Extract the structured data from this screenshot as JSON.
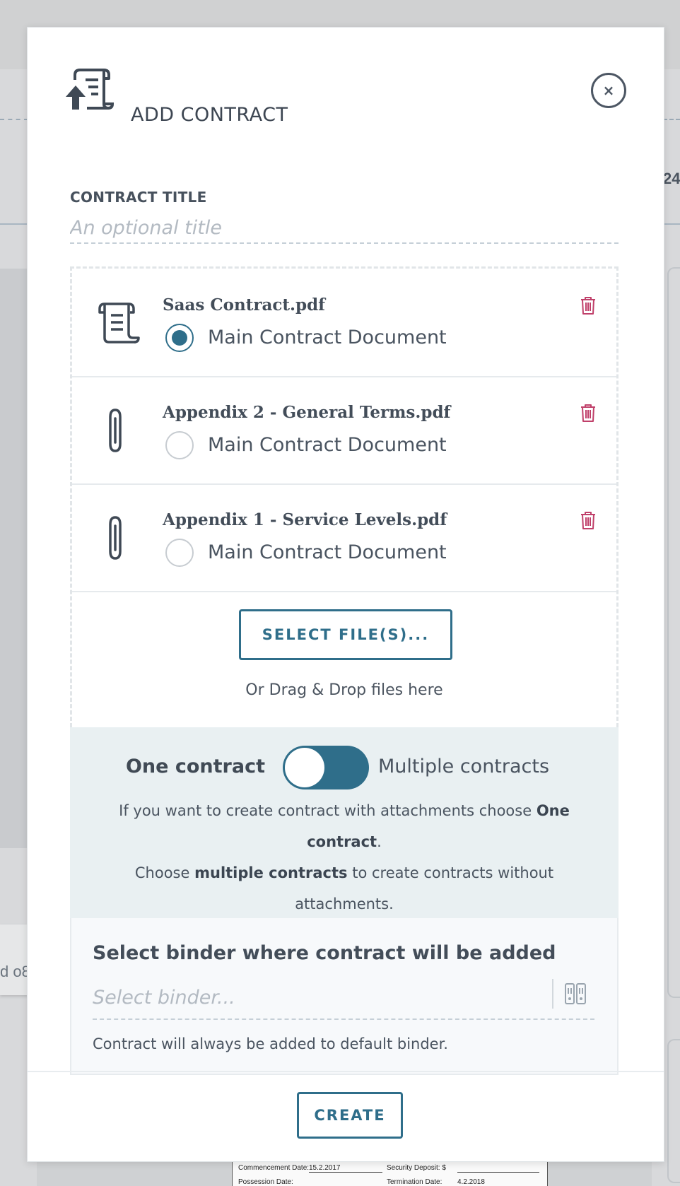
{
  "background": {
    "peek_right_text": "24",
    "peek_left_text": "d o8",
    "document_preview": {
      "commencement_label": "Commencement Date:",
      "commencement_value": "15.2.2017",
      "security_label": "Security Deposit: $",
      "possession_label": "Possession Date:",
      "termination_label": "Termination Date:",
      "termination_value": "4.2.2018"
    }
  },
  "modal": {
    "title": "ADD CONTRACT",
    "header_icon": "scroll-upload-icon",
    "close_icon": "close-icon",
    "close_symbol": "×",
    "contract_title": {
      "label": "CONTRACT TITLE",
      "placeholder": "An optional title",
      "value": ""
    },
    "files": [
      {
        "name": "Saas Contract.pdf",
        "icon": "scroll-icon",
        "radio_label": "Main Contract Document",
        "is_main": true
      },
      {
        "name": "Appendix 2 - General Terms.pdf",
        "icon": "paperclip-icon",
        "radio_label": "Main Contract Document",
        "is_main": false
      },
      {
        "name": "Appendix 1 - Service Levels.pdf",
        "icon": "paperclip-icon",
        "radio_label": "Main Contract Document",
        "is_main": false
      }
    ],
    "select_files_label": "SELECT FILE(S)...",
    "drag_hint": "Or Drag & Drop files here",
    "toggle": {
      "left_label": "One contract",
      "right_label": "Multiple contracts",
      "state": "one",
      "help_1_pre": "If you want to create contract with attachments choose ",
      "help_1_bold": "One contract",
      "help_1_post": ".",
      "help_2_pre": "Choose ",
      "help_2_bold": "multiple contracts",
      "help_2_post": " to create contracts without attachments."
    },
    "binder": {
      "title": "Select binder where contract will be added",
      "placeholder": "Select binder...",
      "icon": "binder-icon",
      "note": "Contract will always be added to default binder."
    },
    "create_label": "CREATE"
  },
  "colors": {
    "accent": "#2f6e8a",
    "danger": "#c0406a",
    "text": "#3c4653",
    "toggle_bg": "#e9f0f2"
  }
}
